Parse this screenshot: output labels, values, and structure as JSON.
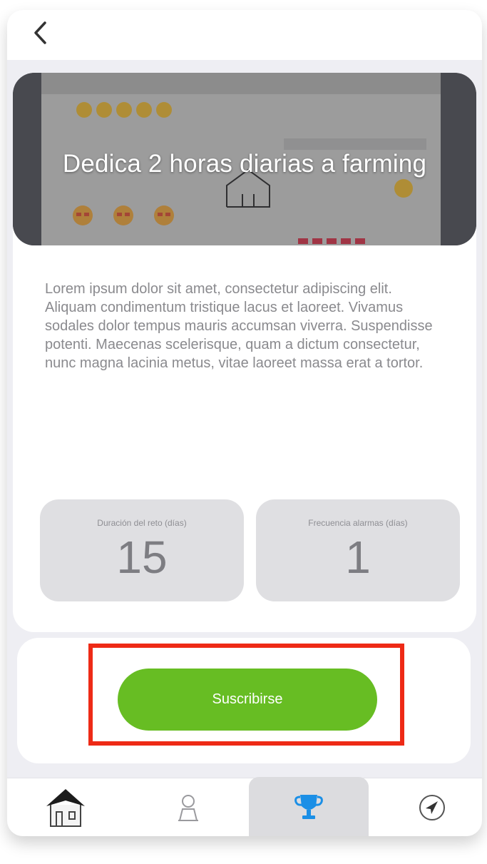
{
  "header": {
    "back_icon": "chevron-left-icon"
  },
  "challenge": {
    "title": "Dedica 2 horas diarias a farming",
    "description": "Lorem ipsum dolor sit amet, consectetur adipiscing elit. Aliquam condimentum tristique lacus et laoreet. Vivamus sodales dolor tempus mauris accumsan viverra. Suspendisse potenti. Maecenas scelerisque, quam a dictum consectetur, nunc magna lacinia metus, vitae laoreet massa erat a tortor.",
    "duration_label": "Duración del reto (días)",
    "duration_value": "15",
    "frequency_label": "Frecuencia alarmas (días)",
    "frequency_value": "1"
  },
  "subscribe": {
    "label": "Suscribirse"
  },
  "tabs": [
    {
      "name": "home",
      "icon": "house-icon",
      "active": false
    },
    {
      "name": "profile",
      "icon": "person-icon",
      "active": false
    },
    {
      "name": "challenges",
      "icon": "trophy-icon",
      "active": true
    },
    {
      "name": "explore",
      "icon": "navigation-arrow-icon",
      "active": false
    }
  ],
  "colors": {
    "accent_green": "#67bd23",
    "highlight_red": "#ee2a16",
    "trophy_blue": "#1b8fe6",
    "background": "#eeeef3"
  }
}
